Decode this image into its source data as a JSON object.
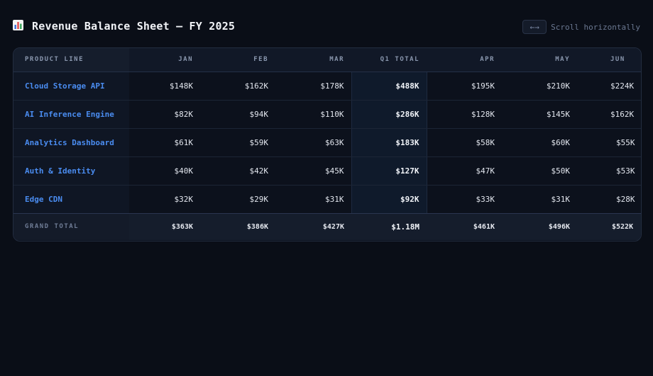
{
  "header": {
    "title": "Revenue Balance Sheet — FY 2025",
    "title_icon": "bar-chart-icon",
    "scroll_badge": "←→",
    "scroll_hint": "Scroll horizontally"
  },
  "table": {
    "columns": [
      "PRODUCT LINE",
      "JAN",
      "FEB",
      "MAR",
      "Q1 TOTAL",
      "APR",
      "MAY",
      "JUN"
    ],
    "rows": [
      {
        "label": "Cloud Storage API",
        "cells": [
          "$148K",
          "$162K",
          "$178K",
          "$488K",
          "$195K",
          "$210K",
          "$224K"
        ]
      },
      {
        "label": "AI Inference Engine",
        "cells": [
          "$82K",
          "$94K",
          "$110K",
          "$286K",
          "$128K",
          "$145K",
          "$162K"
        ]
      },
      {
        "label": "Analytics Dashboard",
        "cells": [
          "$61K",
          "$59K",
          "$63K",
          "$183K",
          "$58K",
          "$60K",
          "$55K"
        ]
      },
      {
        "label": "Auth & Identity",
        "cells": [
          "$40K",
          "$42K",
          "$45K",
          "$127K",
          "$47K",
          "$50K",
          "$53K"
        ]
      },
      {
        "label": "Edge CDN",
        "cells": [
          "$32K",
          "$29K",
          "$31K",
          "$92K",
          "$33K",
          "$31K",
          "$28K"
        ]
      }
    ],
    "total": {
      "label": "GRAND TOTAL",
      "cells": [
        "$363K",
        "$386K",
        "$427K",
        "$1.18M",
        "$461K",
        "$496K",
        "$522K"
      ]
    }
  },
  "colors": {
    "background": "#0a0e17",
    "accent": "#4a8cf0",
    "q1_highlight": "#0f1a2b"
  }
}
